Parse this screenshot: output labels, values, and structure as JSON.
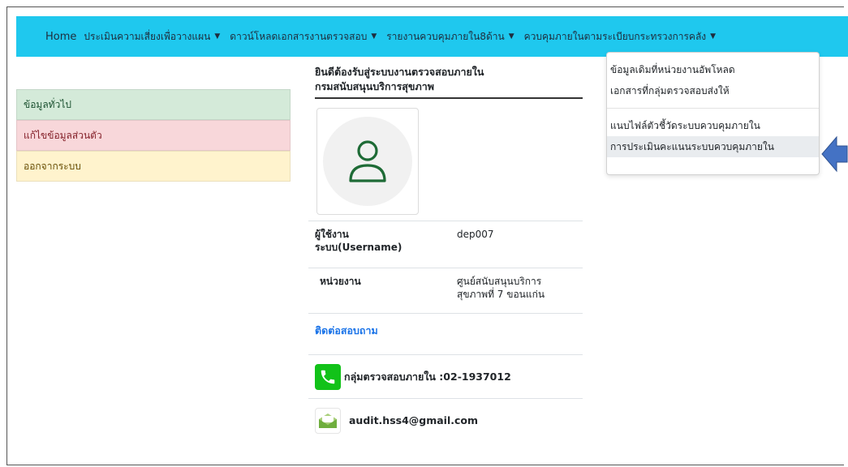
{
  "navbar": {
    "home": "Home",
    "menus": [
      "ประเมินความเสี่ยงเพื่อวางแผน",
      "ดาวน์โหลดเอกสารงานตรวจสอบ",
      "รายงานควบคุมภายใน8ด้าน",
      "ควบคุมภายในตามระเบียบกระทรวงการคลัง"
    ]
  },
  "sidebar": {
    "items": [
      "ข้อมูลทั่วไป",
      "แก้ไขข้อมูลส่วนตัว",
      "ออกจากระบบ"
    ]
  },
  "welcome": {
    "line1": "ยินดีต้องรับสู่ระบบงานตรวจสอบภายใน",
    "line2": "กรมสนับสนุนบริการสุขภาพ"
  },
  "info": {
    "username_label_1": "ผู้ใช้งาน",
    "username_label_2": "ระบบ(Username)",
    "username_value": "dep007",
    "unit_label": "หน่วยงาน",
    "unit_value_1": "ศูนย์สนับสนุนบริการ",
    "unit_value_2": "สุขภาพที่ 7 ขอนแก่น"
  },
  "contact": {
    "link": "ติดต่อสอบถาม",
    "phone": "กลุ่มตรวจสอบภายใน :02-1937012",
    "email": "audit.hss4@gmail.com"
  },
  "dropdown": {
    "items": [
      "ข้อมูลเดิมที่หน่วยงานอัพโหลด",
      "เอกสารที่กลุ่มตรวจสอบส่งให้",
      "แนบไฟล์ตัวชี้วัดระบบควบคุมภายใน",
      "การประเมินคะแนนระบบควบคุมภายใน"
    ]
  },
  "colors": {
    "navbar": "#1fc8ee",
    "arrow": "#4472c4",
    "link": "#1a73e8"
  }
}
